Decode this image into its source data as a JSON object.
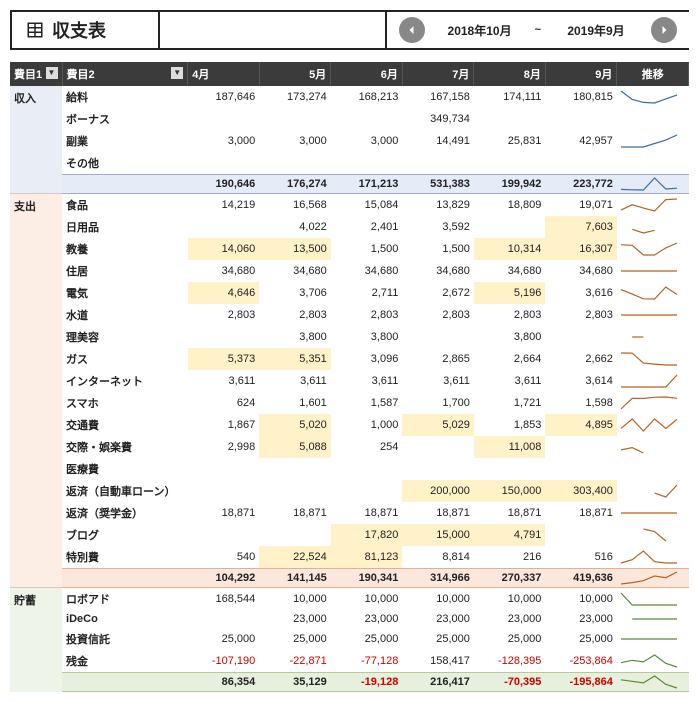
{
  "header": {
    "title": "収支表",
    "period_from": "2018年10月",
    "period_to": "2019年9月",
    "separator": "~"
  },
  "columns": {
    "cat1": "費目1",
    "cat2": "費目2",
    "months": [
      "4月",
      "5月",
      "6月",
      "7月",
      "8月",
      "9月"
    ],
    "trend": "推移"
  },
  "sections": [
    {
      "id": "income",
      "cat1": "収入",
      "rows": [
        {
          "cat2": "給料",
          "v": [
            "187,646",
            "173,274",
            "168,213",
            "167,158",
            "174,111",
            "180,815"
          ]
        },
        {
          "cat2": "ボーナス",
          "v": [
            "",
            "",
            "",
            "349,734",
            "",
            ""
          ]
        },
        {
          "cat2": "副業",
          "v": [
            "3,000",
            "3,000",
            "3,000",
            "14,491",
            "25,831",
            "42,957"
          ]
        },
        {
          "cat2": "その他",
          "v": [
            "",
            "",
            "",
            "",
            "",
            ""
          ]
        }
      ],
      "subtotal": [
        "190,646",
        "176,274",
        "171,213",
        "531,383",
        "199,942",
        "223,772"
      ]
    },
    {
      "id": "expense",
      "cat1": "支出",
      "rows": [
        {
          "cat2": "食品",
          "v": [
            "14,219",
            "16,568",
            "15,084",
            "13,829",
            "18,809",
            "19,071"
          ]
        },
        {
          "cat2": "日用品",
          "v": [
            "",
            "4,022",
            "2,401",
            "3,592",
            "",
            "7,603"
          ],
          "hl": [
            5
          ]
        },
        {
          "cat2": "教養",
          "v": [
            "14,060",
            "13,500",
            "1,500",
            "1,500",
            "10,314",
            "16,307"
          ],
          "hl": [
            0,
            1,
            4,
            5
          ]
        },
        {
          "cat2": "住居",
          "v": [
            "34,680",
            "34,680",
            "34,680",
            "34,680",
            "34,680",
            "34,680"
          ]
        },
        {
          "cat2": "電気",
          "v": [
            "4,646",
            "3,706",
            "2,711",
            "2,672",
            "5,196",
            "3,616"
          ],
          "hl": [
            0,
            4
          ]
        },
        {
          "cat2": "水道",
          "v": [
            "2,803",
            "2,803",
            "2,803",
            "2,803",
            "2,803",
            "2,803"
          ]
        },
        {
          "cat2": "理美容",
          "v": [
            "",
            "3,800",
            "3,800",
            "",
            "3,800",
            ""
          ]
        },
        {
          "cat2": "ガス",
          "v": [
            "5,373",
            "5,351",
            "3,096",
            "2,865",
            "2,664",
            "2,662"
          ],
          "hl": [
            0,
            1
          ]
        },
        {
          "cat2": "インターネット",
          "v": [
            "3,611",
            "3,611",
            "3,611",
            "3,611",
            "3,611",
            "3,614"
          ]
        },
        {
          "cat2": "スマホ",
          "v": [
            "624",
            "1,601",
            "1,587",
            "1,700",
            "1,721",
            "1,598"
          ]
        },
        {
          "cat2": "交通費",
          "v": [
            "1,867",
            "5,020",
            "1,000",
            "5,029",
            "1,853",
            "4,895"
          ],
          "hl": [
            1,
            3,
            5
          ]
        },
        {
          "cat2": "交際・娯楽費",
          "v": [
            "2,998",
            "5,088",
            "254",
            "",
            "11,008",
            ""
          ],
          "hl": [
            1,
            4
          ]
        },
        {
          "cat2": "医療費",
          "v": [
            "",
            "",
            "",
            "",
            "",
            ""
          ]
        },
        {
          "cat2": "返済（自動車ローン）",
          "v": [
            "",
            "",
            "",
            "200,000",
            "150,000",
            "303,400"
          ],
          "hl": [
            3,
            4,
            5
          ]
        },
        {
          "cat2": "返済（奨学金）",
          "v": [
            "18,871",
            "18,871",
            "18,871",
            "18,871",
            "18,871",
            "18,871"
          ]
        },
        {
          "cat2": "ブログ",
          "v": [
            "",
            "",
            "17,820",
            "15,000",
            "4,791",
            ""
          ],
          "hl": [
            2,
            3,
            4
          ]
        },
        {
          "cat2": "特別費",
          "v": [
            "540",
            "22,524",
            "81,123",
            "8,814",
            "216",
            "516"
          ],
          "hl": [
            1,
            2
          ]
        }
      ],
      "subtotal": [
        "104,292",
        "141,145",
        "190,341",
        "314,966",
        "270,337",
        "419,636"
      ]
    },
    {
      "id": "savings",
      "cat1": "貯蓄",
      "rows": [
        {
          "cat2": "ロボアド",
          "v": [
            "168,544",
            "10,000",
            "10,000",
            "10,000",
            "10,000",
            "10,000"
          ]
        },
        {
          "cat2": "iDeCo",
          "v": [
            "",
            "23,000",
            "23,000",
            "23,000",
            "23,000",
            "23,000"
          ]
        },
        {
          "cat2": "投資信託",
          "v": [
            "25,000",
            "25,000",
            "25,000",
            "25,000",
            "25,000",
            "25,000"
          ]
        },
        {
          "cat2": "残金",
          "v": [
            "-107,190",
            "-22,871",
            "-77,128",
            "158,417",
            "-128,395",
            "-253,864"
          ]
        }
      ],
      "subtotal": [
        "86,354",
        "35,129",
        "-19,128",
        "216,417",
        "-70,395",
        "-195,864"
      ]
    }
  ],
  "icons": {
    "prev": "←",
    "next": "→",
    "dropdown": "▼"
  }
}
